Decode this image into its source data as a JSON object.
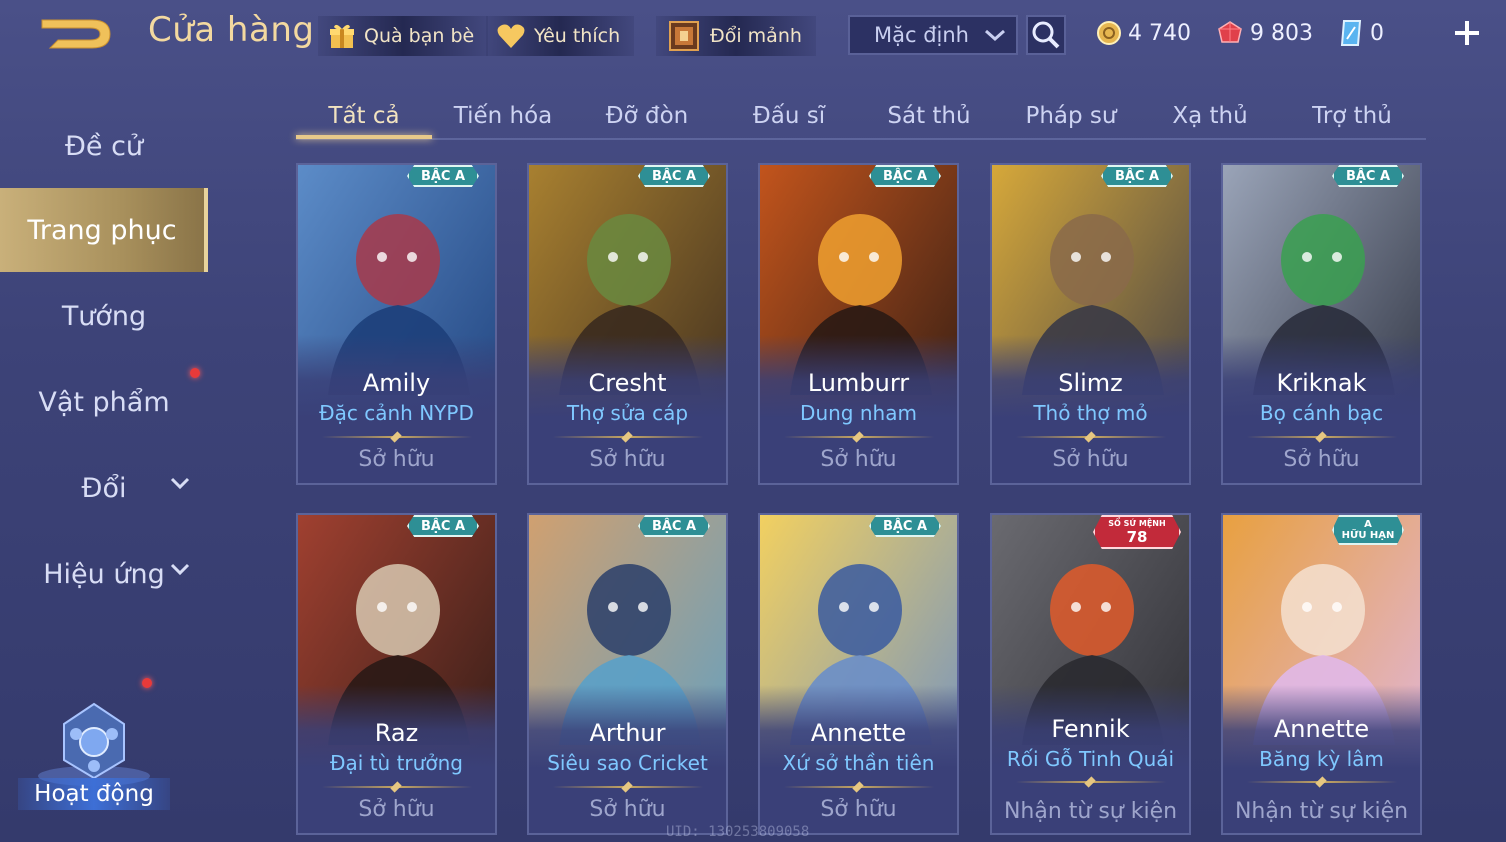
{
  "header": {
    "title": "Cửa hàng",
    "friend_gift": "Quà bạn bè",
    "favorites": "Yêu thích",
    "exchange_shards": "Đổi mảnh",
    "sort_value": "Mặc định"
  },
  "currencies": {
    "gold": "4 740",
    "vouchers": "9 803",
    "gems": "0"
  },
  "sidebar": {
    "items": [
      {
        "label": "Đề cử"
      },
      {
        "label": "Trang phục"
      },
      {
        "label": "Tướng"
      },
      {
        "label": "Vật phẩm"
      },
      {
        "label": "Đổi"
      },
      {
        "label": "Hiệu ứng"
      }
    ],
    "event_label": "Hoạt động"
  },
  "tabs": [
    "Tất cả",
    "Tiến hóa",
    "Đỡ đòn",
    "Đấu sĩ",
    "Sát thủ",
    "Pháp sư",
    "Xạ thủ",
    "Trợ thủ"
  ],
  "active_tab": "Tất cả",
  "cards": [
    {
      "hero": "Amily",
      "skin": "Đặc cảnh NYPD",
      "status": "Sở hữu",
      "badge": "BẬC A",
      "palette": [
        "#1d3f7a",
        "#5c8cc8",
        "#a83a4a"
      ]
    },
    {
      "hero": "Cresht",
      "skin": "Thợ sửa cáp",
      "status": "Sở hữu",
      "badge": "BẬC A",
      "palette": [
        "#3a2a1e",
        "#a88030",
        "#6a8a40"
      ]
    },
    {
      "hero": "Lumburr",
      "skin": "Dung nham",
      "status": "Sở hữu",
      "badge": "BẬC A",
      "palette": [
        "#2a1a14",
        "#c2541c",
        "#f0a030"
      ]
    },
    {
      "hero": "Slimz",
      "skin": "Thỏ thợ mỏ",
      "status": "Sở hữu",
      "badge": "BẬC A",
      "palette": [
        "#3a3a46",
        "#d6a83a",
        "#8a6a4a"
      ]
    },
    {
      "hero": "Kriknak",
      "skin": "Bọ cánh bạc",
      "status": "Sở hữu",
      "badge": "BẬC A",
      "palette": [
        "#2a2e3c",
        "#9aa4b8",
        "#3aa050"
      ]
    },
    {
      "hero": "Raz",
      "skin": "Đại tù trưởng",
      "status": "Sở hữu",
      "badge": "BẬC A",
      "palette": [
        "#2a1a16",
        "#a04030",
        "#d8c8b0"
      ]
    },
    {
      "hero": "Arthur",
      "skin": "Siêu sao Cricket",
      "status": "Sở hữu",
      "badge": "BẬC A",
      "palette": [
        "#5aa0c8",
        "#d0a070",
        "#2a3e6a"
      ]
    },
    {
      "hero": "Annette",
      "skin": "Xứ sở thần tiên",
      "status": "Sở hữu",
      "badge": "BẬC A",
      "palette": [
        "#6a8ec8",
        "#f2d060",
        "#3a5aa0"
      ]
    },
    {
      "hero": "Fennik",
      "skin": "Rối Gỗ Tinh Quái",
      "status": "Nhận từ sự kiện",
      "badge": "SỔ SỨ MỆNH",
      "badge_num": "78",
      "palette": [
        "#2a2a30",
        "#6a6a70",
        "#e05a2a"
      ]
    },
    {
      "hero": "Annette",
      "skin": "Băng kỳ lâm",
      "status": "Nhận từ sự kiện",
      "badge": "A",
      "badge_sub": "HỮU HẠN",
      "palette": [
        "#e0b8e8",
        "#e8a040",
        "#f4e0d0"
      ]
    }
  ],
  "uid_text": "UID: 130253809058",
  "colors": {
    "accent_gold": "#e8c98a",
    "skin_blue": "#7fc8ff",
    "badge_teal": "#2e8f95",
    "event_red": "#c22a3a"
  }
}
